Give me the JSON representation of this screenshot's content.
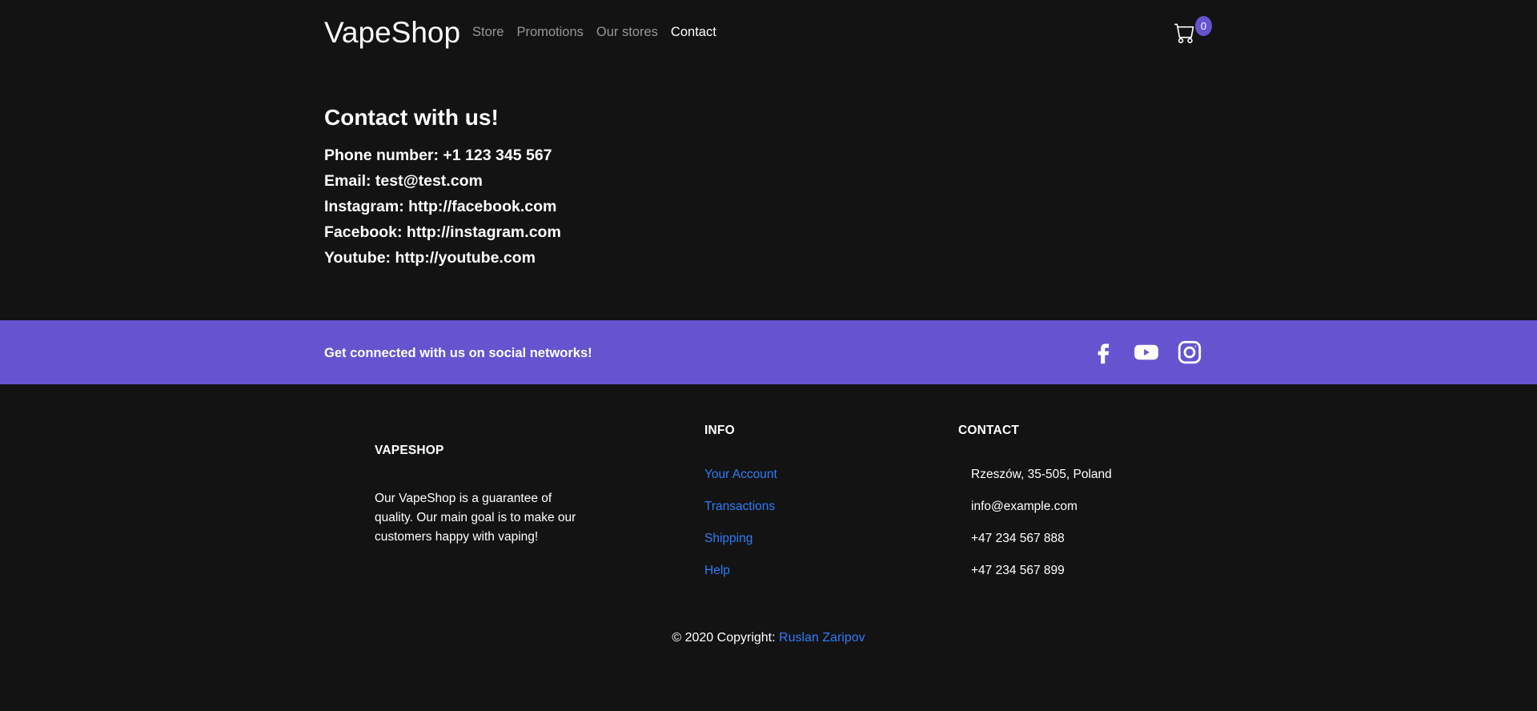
{
  "navbar": {
    "brand": "VapeShop",
    "links": [
      {
        "label": "Store",
        "active": false
      },
      {
        "label": "Promotions",
        "active": false
      },
      {
        "label": "Our stores",
        "active": false
      },
      {
        "label": "Contact",
        "active": true
      }
    ],
    "cart": {
      "icon": "cart-icon",
      "count": "0"
    }
  },
  "contact": {
    "title": "Contact with us!",
    "lines": [
      "Phone number: +1 123 345 567",
      "Email: test@test.com",
      "Instagram: http://facebook.com",
      "Facebook: http://instagram.com",
      "Youtube: http://youtube.com"
    ]
  },
  "social_bar": {
    "text": "Get connected with us on social networks!",
    "icons": [
      "facebook-icon",
      "youtube-icon",
      "instagram-icon"
    ],
    "background": "#6554cf"
  },
  "footer": {
    "about": {
      "heading": "VAPESHOP",
      "text": "Our VapeShop is a guarantee of quality. Our main goal is to make our customers happy with vaping!"
    },
    "info": {
      "heading": "INFO",
      "links": [
        "Your Account",
        "Transactions",
        "Shipping",
        "Help"
      ]
    },
    "contact": {
      "heading": "CONTACT",
      "items": [
        "Rzeszów, 35-505, Poland",
        "info@example.com",
        "+47 234 567 888",
        "+47 234 567 899"
      ]
    },
    "copyright": {
      "prefix": "© 2020 Copyright:",
      "author": "Ruslan Zaripov"
    }
  },
  "colors": {
    "background": "#131314",
    "accent": "#6554cf",
    "link": "#2e7df6"
  }
}
